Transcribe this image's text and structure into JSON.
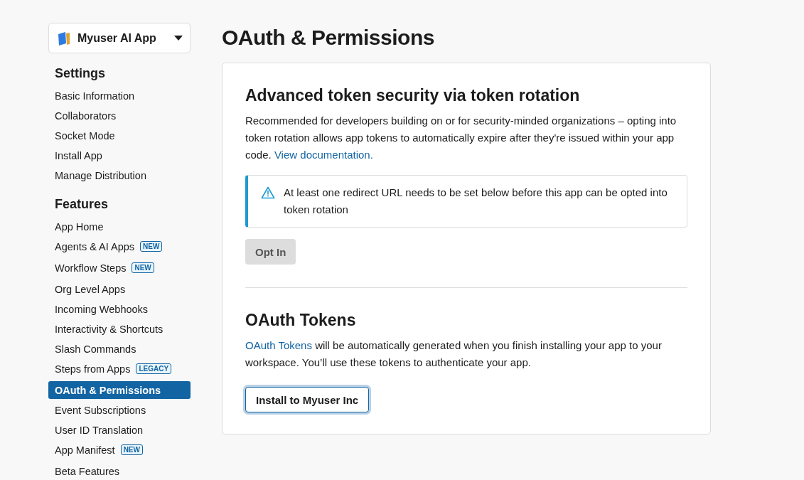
{
  "app_switcher": {
    "name": "Myuser AI App"
  },
  "sidebar": {
    "sections": [
      {
        "title": "Settings",
        "items": [
          {
            "label": "Basic Information",
            "selected": false
          },
          {
            "label": "Collaborators",
            "selected": false
          },
          {
            "label": "Socket Mode",
            "selected": false
          },
          {
            "label": "Install App",
            "selected": false
          },
          {
            "label": "Manage Distribution",
            "selected": false
          }
        ]
      },
      {
        "title": "Features",
        "items": [
          {
            "label": "App Home",
            "selected": false
          },
          {
            "label": "Agents & AI Apps",
            "selected": false,
            "badge": "NEW"
          },
          {
            "label": "Workflow Steps",
            "selected": false,
            "badge": "NEW"
          },
          {
            "label": "Org Level Apps",
            "selected": false
          },
          {
            "label": "Incoming Webhooks",
            "selected": false
          },
          {
            "label": "Interactivity & Shortcuts",
            "selected": false
          },
          {
            "label": "Slash Commands",
            "selected": false
          },
          {
            "label": "Steps from Apps",
            "selected": false,
            "badge": "LEGACY"
          },
          {
            "label": "OAuth & Permissions",
            "selected": true
          },
          {
            "label": "Event Subscriptions",
            "selected": false
          },
          {
            "label": "User ID Translation",
            "selected": false
          },
          {
            "label": "App Manifest",
            "selected": false,
            "badge": "NEW"
          },
          {
            "label": "Beta Features",
            "selected": false
          }
        ]
      }
    ]
  },
  "page_title": "OAuth & Permissions",
  "token_rotation": {
    "title": "Advanced token security via token rotation",
    "description": "Recommended for developers building on or for security-minded organizations – opting into token rotation allows app tokens to automatically expire after they're issued within your app code.",
    "link": "View documentation.",
    "warning": "At least one redirect URL needs to be set below before this app can be opted into token rotation",
    "button": {
      "label": "Opt In",
      "disabled": true
    }
  },
  "oauth_tokens": {
    "title": "OAuth Tokens",
    "link": "OAuth Tokens",
    "description": "will be automatically generated when you finish installing your app to your workspace. You’ll use these tokens to authenticate your app.",
    "button": {
      "label": "Install to Myuser Inc",
      "focused": true
    }
  }
}
